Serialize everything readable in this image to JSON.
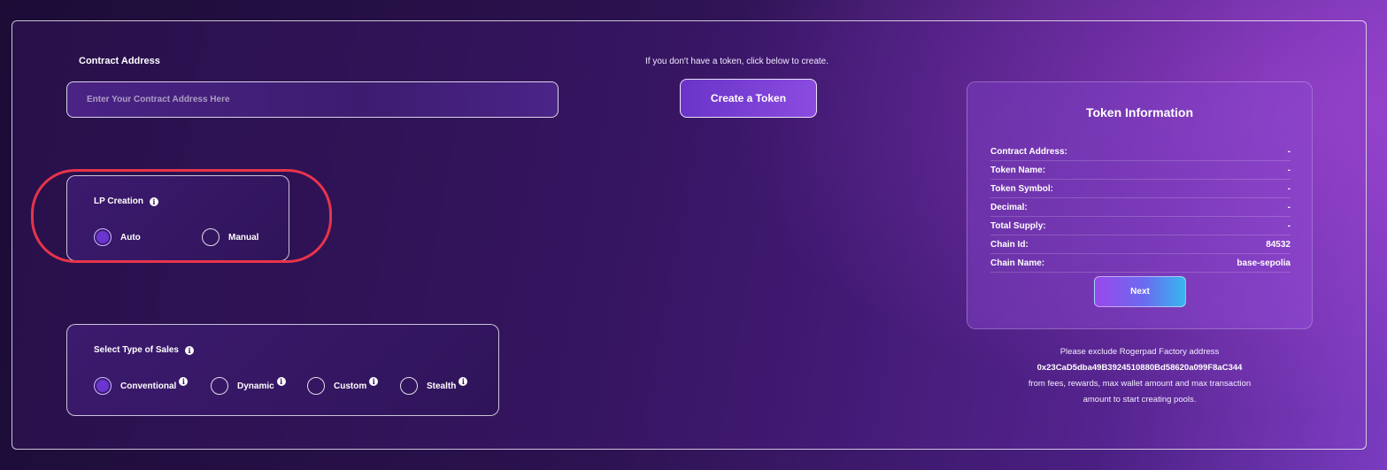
{
  "contract": {
    "label": "Contract Address",
    "placeholder": "Enter Your Contract Address Here",
    "value": ""
  },
  "create_token": {
    "hint": "If you don't have a token, click below to create.",
    "button_label": "Create a Token"
  },
  "lp_creation": {
    "title": "LP Creation",
    "options": [
      {
        "label": "Auto",
        "selected": true
      },
      {
        "label": "Manual",
        "selected": false
      }
    ]
  },
  "sales_type": {
    "title": "Select Type of Sales",
    "options": [
      {
        "label": "Conventional",
        "selected": true
      },
      {
        "label": "Dynamic",
        "selected": false
      },
      {
        "label": "Custom",
        "selected": false
      },
      {
        "label": "Stealth",
        "selected": false
      }
    ]
  },
  "token_info": {
    "title": "Token Information",
    "rows": [
      {
        "label": "Contract Address:",
        "value": "-"
      },
      {
        "label": "Token Name:",
        "value": "-"
      },
      {
        "label": "Token Symbol:",
        "value": "-"
      },
      {
        "label": "Decimal:",
        "value": "-"
      },
      {
        "label": "Total Supply:",
        "value": "-"
      },
      {
        "label": "Chain Id:",
        "value": "84532"
      },
      {
        "label": "Chain Name:",
        "value": "base-sepolia"
      }
    ],
    "next_label": "Next"
  },
  "exclude_note": {
    "line1": "Please exclude Rogerpad Factory address",
    "address": "0x23CaD5dba49B3924510880Bd58620a099F8aC344",
    "line3": "from fees, rewards, max wallet amount and max transaction",
    "line4": "amount to start creating pools."
  },
  "icons": {
    "info": "info-icon"
  },
  "colors": {
    "accent_purple": "#6a35cf",
    "highlight_red": "#e8344a",
    "next_gradient_end": "#38b6f0"
  }
}
